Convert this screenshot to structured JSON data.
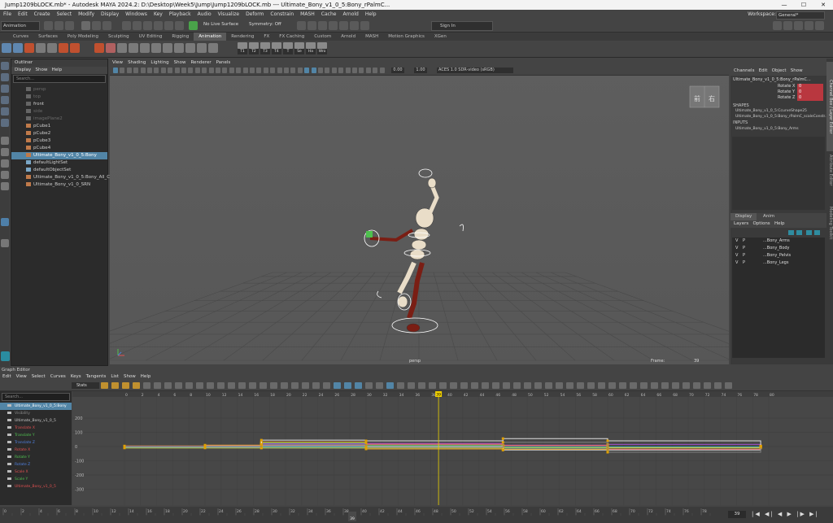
{
  "window": {
    "title": "Jump1209bLOCK.mb* - Autodesk MAYA 2024.2: D:\\Desktop\\Week5\\Jump\\Jump1209bLOCK.mb  ---  Ultimate_Bony_v1_0_5:Bony_rPalmC...",
    "minimize": "—",
    "maximize": "☐",
    "close": "✕"
  },
  "menubar": [
    "File",
    "Edit",
    "Create",
    "Select",
    "Modify",
    "Display",
    "Windows",
    "Key",
    "Playback",
    "Audio",
    "Visualize",
    "Deform",
    "Constrain",
    "MASH",
    "Cache",
    "Arnold",
    "Help"
  ],
  "workspace": {
    "label": "Workspace:",
    "value": "General*"
  },
  "status": {
    "mode": "Animation",
    "live_surface": "No Live Surface",
    "symmetry": "Symmetry: Off",
    "sign_in": "Sign In"
  },
  "shelf_tabs": [
    "Curves",
    "Surfaces",
    "Poly Modeling",
    "Sculpting",
    "UV Editing",
    "Rigging",
    "Animation",
    "Rendering",
    "FX",
    "FX Caching",
    "Custom",
    "Arnold",
    "MASH",
    "Motion Graphics",
    "XGen"
  ],
  "shelf_active": "Animation",
  "shelf_labels": [
    "T1",
    "T2",
    "T3",
    "T4",
    "T",
    "Se",
    "Ha",
    "Wro"
  ],
  "outliner": {
    "title": "Outliner",
    "menu": [
      "Display",
      "Show",
      "Help"
    ],
    "search_placeholder": "Search...",
    "items": [
      {
        "label": "persp",
        "dim": true,
        "sel": false
      },
      {
        "label": "top",
        "dim": true,
        "sel": false
      },
      {
        "label": "front",
        "dim": false,
        "sel": false
      },
      {
        "label": "side",
        "dim": true,
        "sel": false
      },
      {
        "label": "imagePlane2",
        "dim": true,
        "sel": false
      },
      {
        "label": "pCube1",
        "dim": false,
        "sel": false
      },
      {
        "label": "pCube2",
        "dim": false,
        "sel": false
      },
      {
        "label": "pCube3",
        "dim": false,
        "sel": false
      },
      {
        "label": "pCube4",
        "dim": false,
        "sel": false
      },
      {
        "label": "Ultimate_Bony_v1_0_5:Bony",
        "dim": false,
        "sel": true
      },
      {
        "label": "defaultLightSet",
        "dim": false,
        "sel": false
      },
      {
        "label": "defaultObjectSet",
        "dim": false,
        "sel": false
      },
      {
        "label": "Ultimate_Bony_v1_0_5:Bony_All_CNTs",
        "dim": false,
        "sel": false
      },
      {
        "label": "Ultimate_Bony_v1_0_SRN",
        "dim": false,
        "sel": false
      }
    ]
  },
  "viewport": {
    "menu": [
      "View",
      "Shading",
      "Lighting",
      "Show",
      "Renderer",
      "Panels"
    ],
    "exposure": "0.00",
    "gamma": "1.00",
    "colorspace": "ACES 1.0 SDR-video (sRGB)",
    "camera": "persp",
    "frame_label": "Frame:",
    "frame_value": "39",
    "cube_labels": [
      "前",
      "右"
    ]
  },
  "channel_box": {
    "menu": [
      "Channels",
      "Edit",
      "Object",
      "Show"
    ],
    "object": "Ultimate_Bony_v1_0_5:Bony_rPalmC...",
    "attrs": [
      {
        "name": "Rotate X",
        "value": "0"
      },
      {
        "name": "Rotate Y",
        "value": "0"
      },
      {
        "name": "Rotate Z",
        "value": "0"
      }
    ],
    "shapes_label": "SHAPES",
    "shape": "Ultimate_Bony_v1_0_5:CcurveShape25",
    "shape2": "Ultimate_Bony_v1_0_5:Bony_rPalmC_scaleConstr...",
    "inputs_label": "INPUTS",
    "input": "Ultimate_Bony_v1_0_5:Bony_Arms"
  },
  "layers": {
    "tabs": [
      "Display",
      "Anim"
    ],
    "menu": [
      "Layers",
      "Options",
      "Help"
    ],
    "items": [
      {
        "v": "V",
        "p": "P",
        "name": "...Bony_Arms"
      },
      {
        "v": "V",
        "p": "P",
        "name": "...Bony_Body"
      },
      {
        "v": "V",
        "p": "P",
        "name": "...Bony_Pelvis"
      },
      {
        "v": "V",
        "p": "P",
        "name": "...Bony_Legs"
      }
    ]
  },
  "side_tabs": [
    "Channel Box / Layer Editor",
    "Attribute Editor",
    "Modeling Toolkit"
  ],
  "graph_editor": {
    "title": "Graph Editor",
    "menu": [
      "Edit",
      "View",
      "Select",
      "Curves",
      "Keys",
      "Tangents",
      "List",
      "Show",
      "Help"
    ],
    "stats_label": "Stats",
    "search_placeholder": "Search...",
    "channels": [
      {
        "label": "Ultimate_Bony_v1_0_5:Bony",
        "color": "#ffffff",
        "sel": true
      },
      {
        "label": "Visibility",
        "color": "#8c8c8c",
        "sel": false
      },
      {
        "label": "Ultimate_Bony_v1_0_5",
        "color": "#cccccc",
        "sel": false
      },
      {
        "label": "Translate X",
        "color": "#e05050",
        "sel": false
      },
      {
        "label": "Translate Y",
        "color": "#50c050",
        "sel": false
      },
      {
        "label": "Translate Z",
        "color": "#5080e0",
        "sel": false
      },
      {
        "label": "Rotate X",
        "color": "#e05050",
        "sel": false
      },
      {
        "label": "Rotate Y",
        "color": "#50c050",
        "sel": false
      },
      {
        "label": "Rotate Z",
        "color": "#5080e0",
        "sel": false
      },
      {
        "label": "Scale X",
        "color": "#e05050",
        "sel": false
      },
      {
        "label": "Scale Y",
        "color": "#50c050",
        "sel": false
      },
      {
        "label": "Ultimate_Bony_v1_0_5",
        "color": "#e05050",
        "sel": false
      }
    ],
    "y_ticks": [
      "200",
      "100",
      "0",
      "-100",
      "-200",
      "-300"
    ],
    "x_ticks": [
      "0",
      "2",
      "4",
      "6",
      "8",
      "10",
      "12",
      "14",
      "16",
      "18",
      "20",
      "22",
      "24",
      "26",
      "28",
      "30",
      "32",
      "34",
      "36",
      "38",
      "40",
      "42",
      "44",
      "46",
      "48",
      "50",
      "52",
      "54",
      "56",
      "58",
      "60",
      "62",
      "64",
      "66",
      "68",
      "70",
      "72",
      "74",
      "76",
      "78",
      "80"
    ],
    "current_frame": "39"
  },
  "timeslider": {
    "ticks": [
      "0",
      "2",
      "4",
      "6",
      "8",
      "10",
      "12",
      "14",
      "16",
      "18",
      "20",
      "22",
      "24",
      "26",
      "28",
      "30",
      "32",
      "34",
      "36",
      "38",
      "40",
      "42",
      "44",
      "46",
      "48",
      "50",
      "52",
      "54",
      "56",
      "58",
      "60",
      "62",
      "64",
      "66",
      "68",
      "70",
      "72",
      "74",
      "76",
      "78"
    ],
    "current": "39",
    "frame_field": "39"
  }
}
